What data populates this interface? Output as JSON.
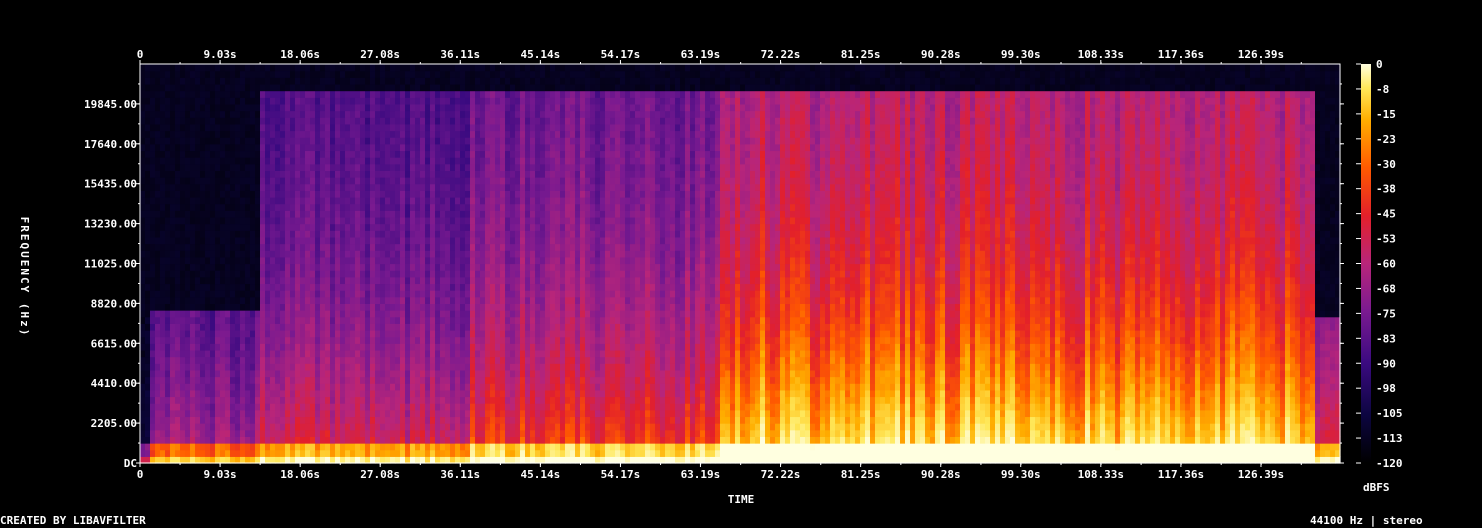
{
  "chart_data": {
    "type": "heatmap",
    "subtype": "spectrogram",
    "xlabel": "TIME",
    "ylabel": "FREQUENCY (Hz)",
    "x_ticks": [
      "0",
      "9.03s",
      "18.06s",
      "27.08s",
      "36.11s",
      "45.14s",
      "54.17s",
      "63.19s",
      "72.22s",
      "81.25s",
      "90.28s",
      "99.30s",
      "108.33s",
      "117.36s",
      "126.39s"
    ],
    "x_tick_values": [
      0,
      9.03,
      18.06,
      27.08,
      36.11,
      45.14,
      54.17,
      63.19,
      72.22,
      81.25,
      90.28,
      99.3,
      108.33,
      117.36,
      126.39
    ],
    "xlim": [
      0,
      135.3
    ],
    "y_ticks": [
      "DC",
      "2205.00",
      "4410.00",
      "6615.00",
      "8820.00",
      "11025.00",
      "13230.00",
      "15435.00",
      "17640.00",
      "19845.00"
    ],
    "y_tick_values": [
      0,
      2205,
      4410,
      6615,
      8820,
      11025,
      13230,
      15435,
      17640,
      19845
    ],
    "ylim": [
      0,
      22050
    ],
    "colorbar": {
      "label": "dBFS",
      "ticks": [
        "0",
        "-8",
        "-15",
        "-23",
        "-30",
        "-38",
        "-45",
        "-53",
        "-60",
        "-68",
        "-75",
        "-83",
        "-90",
        "-98",
        "-105",
        "-113",
        "-120"
      ],
      "range": [
        -120,
        0
      ],
      "colormap": [
        "#000000",
        "#0c0540",
        "#3a0a80",
        "#7a1a90",
        "#b8257a",
        "#e3202a",
        "#ff5a00",
        "#ffae00",
        "#ffe85a",
        "#ffffe0"
      ]
    },
    "segments": [
      {
        "start": 0,
        "end": 1.2,
        "level": 0.08,
        "cutoff_hz": 8400
      },
      {
        "start": 1.2,
        "end": 13.5,
        "level": 0.34,
        "cutoff_hz": 8400
      },
      {
        "start": 13.5,
        "end": 37.0,
        "level": 0.42,
        "cutoff_hz": 20500
      },
      {
        "start": 37.0,
        "end": 65.5,
        "level": 0.5,
        "cutoff_hz": 20500
      },
      {
        "start": 65.5,
        "end": 132.5,
        "level": 0.72,
        "cutoff_hz": 20500
      },
      {
        "start": 132.5,
        "end": 135.3,
        "level": 0.4,
        "cutoff_hz": 8000
      }
    ],
    "grid": false
  },
  "footer": {
    "credit": "CREATED BY LIBAVFILTER",
    "format": "44100 Hz | stereo"
  }
}
